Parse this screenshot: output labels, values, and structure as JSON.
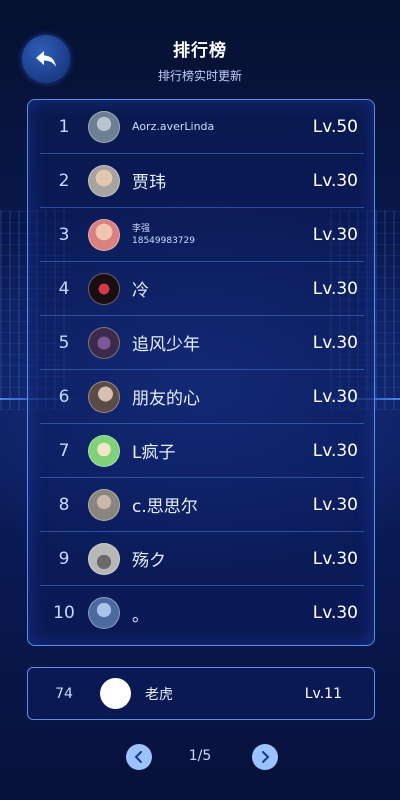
{
  "header": {
    "title": "排行榜",
    "subtitle": "排行榜实时更新"
  },
  "leaderboard": [
    {
      "rank": "1",
      "name": "Aorz.averLinda",
      "level": "Lv.50",
      "avatar_color": "#6d7f92"
    },
    {
      "rank": "2",
      "name": "贾玮",
      "level": "Lv.30",
      "avatar_color": "#a7a3a0"
    },
    {
      "rank": "3",
      "name_line1": "李强",
      "name_line2": "18549983729",
      "level": "Lv.30",
      "avatar_color": "#d98080"
    },
    {
      "rank": "4",
      "name": "冷",
      "level": "Lv.30",
      "avatar_color": "#1a0d12"
    },
    {
      "rank": "5",
      "name": "追风少年",
      "level": "Lv.30",
      "avatar_color": "#3b2a4a"
    },
    {
      "rank": "6",
      "name": "朋友的心",
      "level": "Lv.30",
      "avatar_color": "#5b4b46"
    },
    {
      "rank": "7",
      "name": "L疯子",
      "level": "Lv.30",
      "avatar_color": "#7fd27a"
    },
    {
      "rank": "8",
      "name": "c.思思尔",
      "level": "Lv.30",
      "avatar_color": "#8b8580"
    },
    {
      "rank": "9",
      "name": "殇ク",
      "level": "Lv.30",
      "avatar_color": "#b7b7b7"
    },
    {
      "rank": "10",
      "name": "。",
      "level": "Lv.30",
      "avatar_color": "#4d6aa0"
    }
  ],
  "my_rank": {
    "rank": "74",
    "name": "老虎",
    "level": "Lv.11"
  },
  "pagination": {
    "text": "1/5"
  }
}
